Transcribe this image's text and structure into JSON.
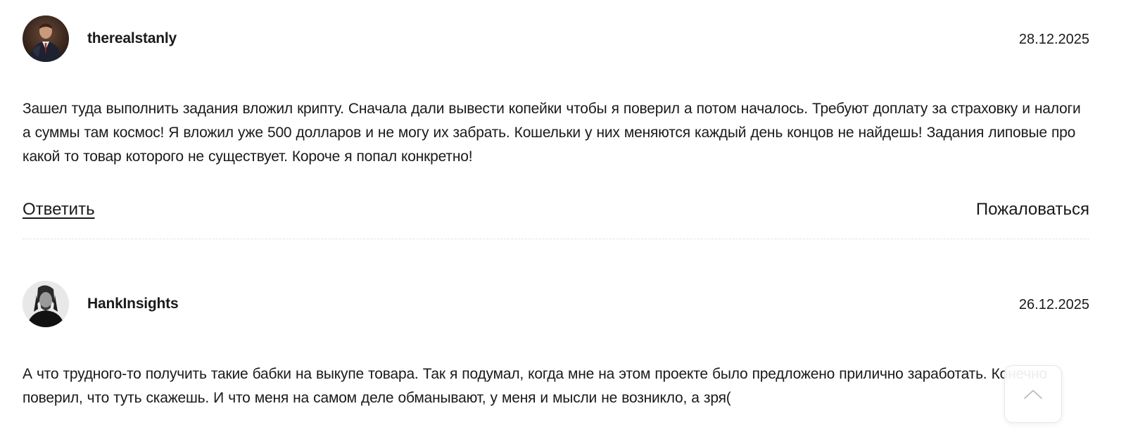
{
  "comments": [
    {
      "author": "therealstanly",
      "date": "28.12.2025",
      "avatar_icon": "user-avatar-suit-photo",
      "text": "Зашел туда выполнить задания вложил крипту. Сначала дали вывести копейки чтобы я поверил а потом началось. Требуют доплату за страховку и налоги а суммы там космос! Я вложил уже 500 долларов и не могу их забрать. Кошельки у них меняются каждый день концов не найдешь! Задания липовые про какой то товар которого не существует. Короче я попал конкретно!",
      "reply_label": "Ответить",
      "report_label": "Пожаловаться"
    },
    {
      "author": "HankInsights",
      "date": "26.12.2025",
      "avatar_icon": "user-avatar-bw-photo",
      "text": "А что трудного-то получить такие бабки на выкупе товара. Так я подумал, когда мне на этом проекте было предложено прилично заработать. Конечно поверил, что туть скажешь. И что меня на самом деле обманывают, у меня и мысли не возникло, а зря("
    }
  ],
  "scroll_top": {
    "icon": "chevron-up-icon"
  },
  "colors": {
    "text": "#1a1a1a",
    "divider": "#e3e3e3",
    "background": "#ffffff"
  }
}
